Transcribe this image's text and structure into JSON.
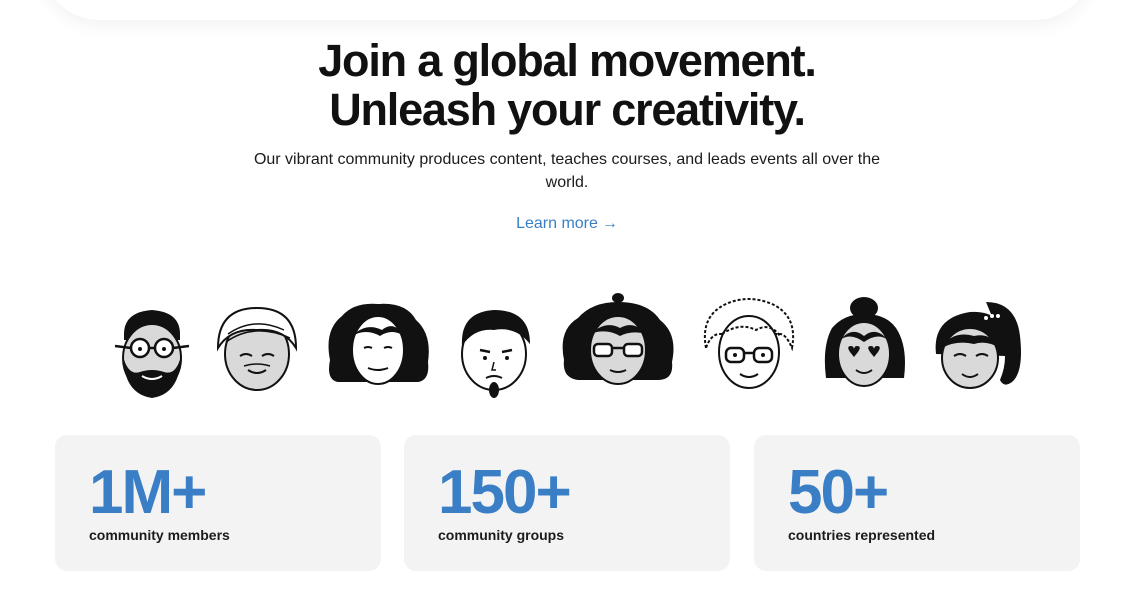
{
  "hero": {
    "headline_line1": "Join a global movement.",
    "headline_line2": "Unleash your creativity.",
    "subtitle": "Our vibrant community produces content, teaches courses, and leads events all over the world.",
    "learn_more": "Learn more",
    "learn_more_arrow": "→"
  },
  "faces": [
    {
      "icon": "bearded-man-face-icon"
    },
    {
      "icon": "turban-elder-face-icon"
    },
    {
      "icon": "curly-hair-woman-face-icon"
    },
    {
      "icon": "goatee-man-face-icon"
    },
    {
      "icon": "beret-glasses-woman-face-icon"
    },
    {
      "icon": "curly-glasses-person-face-icon"
    },
    {
      "icon": "bun-heart-eyes-woman-face-icon"
    },
    {
      "icon": "ponytail-woman-face-icon"
    }
  ],
  "stats": [
    {
      "value": "1M+",
      "label": "community members"
    },
    {
      "value": "150+",
      "label": "community groups"
    },
    {
      "value": "50+",
      "label": "countries represented"
    }
  ],
  "colors": {
    "accent": "#3a7fc6",
    "card_bg": "#f4f3f3",
    "face_skin": "#d9d9d9",
    "ink": "#111111"
  }
}
